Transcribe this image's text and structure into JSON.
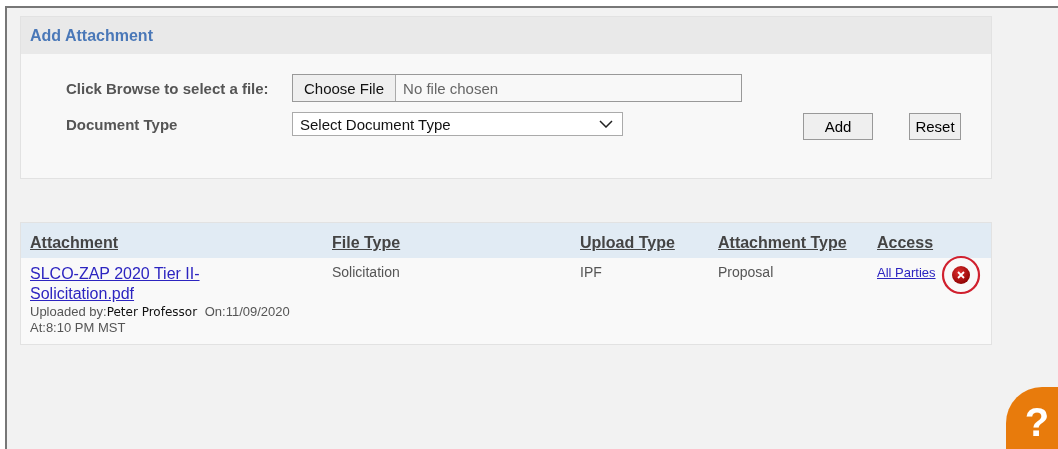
{
  "panel": {
    "title": "Add Attachment",
    "file_label": "Click Browse to select a file:",
    "choose_button": "Choose File",
    "file_status": "No file chosen",
    "type_label": "Document Type",
    "type_select": "Select Document Type",
    "buttons": [
      "Add",
      "Reset"
    ]
  },
  "table": {
    "columns": [
      "Attachment",
      "File Type",
      "Upload Type",
      "Attachment Type",
      "Access"
    ],
    "rows": [
      {
        "file": "SLCO-ZAP 2020 Tier II-Solicitation.pdf",
        "uploaded_label": "Uploaded by:",
        "uploader": "Peter Professor",
        "date": "On:11/09/2020",
        "time": "At:8:10 PM MST",
        "file_type": "Solicitation",
        "upload_type": "IPF",
        "attachment_type": "Proposal",
        "access": "All Parties",
        "delete_highlighted": true
      }
    ]
  },
  "help_button": "?"
}
